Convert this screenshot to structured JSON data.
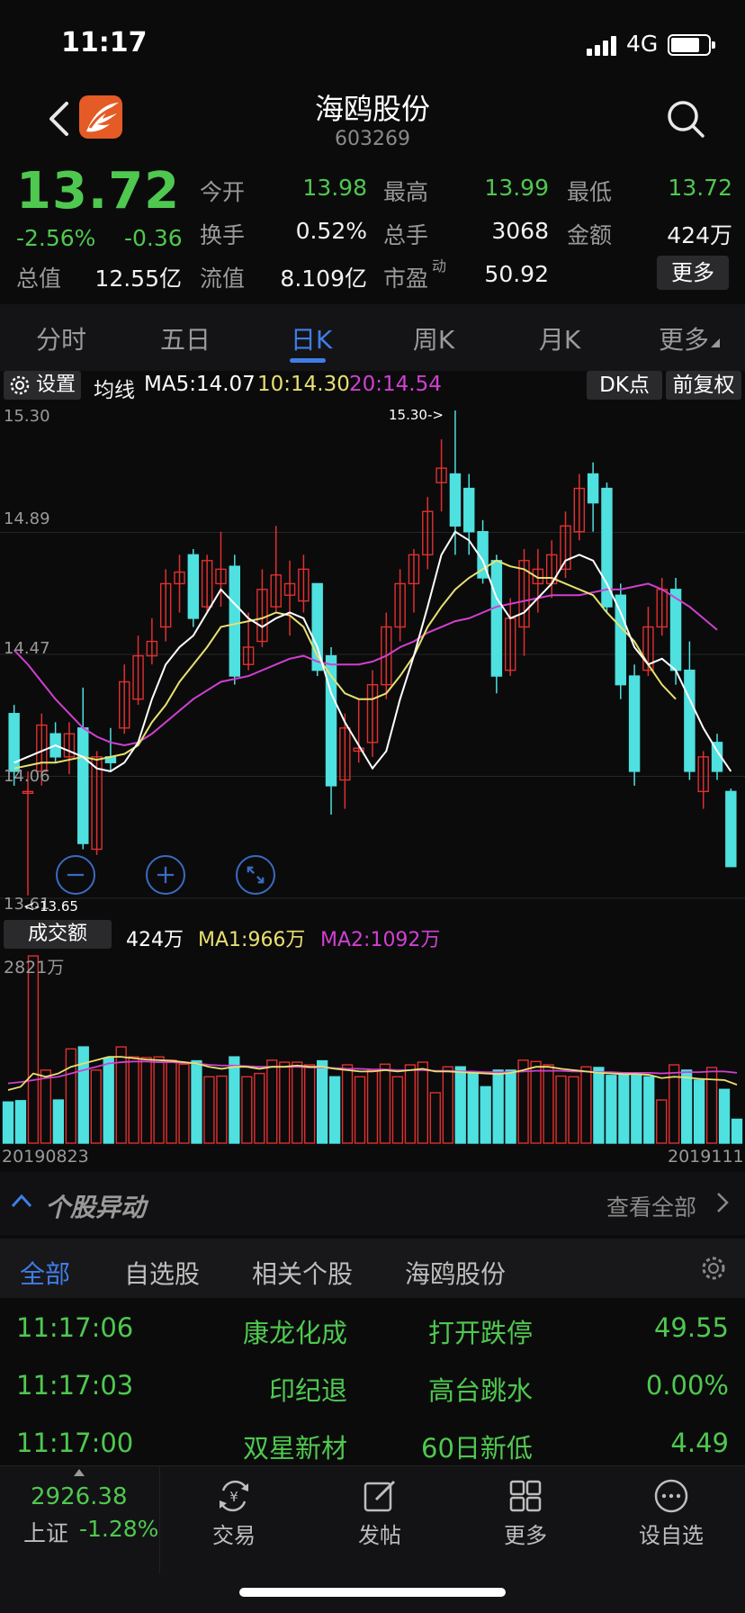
{
  "status": {
    "time": "11:17",
    "network": "4G"
  },
  "header": {
    "title": "海鸥股份",
    "code": "603269"
  },
  "quote": {
    "price": "13.72",
    "pct": "-2.56%",
    "change": "-0.36",
    "fields": [
      {
        "label": "今开",
        "value": "13.98",
        "color": "#4fc84f"
      },
      {
        "label": "最高",
        "value": "13.99",
        "color": "#4fc84f"
      },
      {
        "label": "最低",
        "value": "13.72",
        "color": "#4fc84f"
      },
      {
        "label": "换手",
        "value": "0.52%",
        "color": "#f2f2f2"
      },
      {
        "label": "总手",
        "value": "3068",
        "color": "#f2f2f2"
      },
      {
        "label": "金额",
        "value": "424万",
        "color": "#f2f2f2"
      },
      {
        "label": "总值",
        "value": "12.55亿",
        "color": "#f2f2f2"
      },
      {
        "label": "流值",
        "value": "8.109亿",
        "color": "#f2f2f2"
      },
      {
        "label": "市盈",
        "sup": "动",
        "value": "50.92",
        "color": "#f2f2f2"
      }
    ],
    "more_label": "更多"
  },
  "tabs": [
    "分时",
    "五日",
    "日K",
    "周K",
    "月K",
    "更多"
  ],
  "active_tab": "日K",
  "ma_bar": {
    "settings_label": "设置",
    "prefix": "均线",
    "ma5": "MA5:14.07",
    "ma10": "10:14.30",
    "ma20": "20:14.54",
    "dk_label": "DK点",
    "fq_label": "前复权"
  },
  "colors": {
    "up": "#e0302f",
    "down": "#4fe0e0",
    "ma5": "#ffffff",
    "ma10": "#e8e070",
    "ma20": "#d040d0",
    "accent": "#3f7ee8",
    "green": "#4fc84f"
  },
  "chart_data": {
    "type": "candlestick",
    "y_ticks": [
      "15.30",
      "14.89",
      "14.47",
      "14.06",
      "13.61"
    ],
    "ylim": [
      13.61,
      15.3
    ],
    "max_annotation": "15.30->",
    "min_annotation": "<-13.65",
    "candles": [
      {
        "o": 14.25,
        "h": 14.28,
        "l": 14.0,
        "c": 14.05
      },
      {
        "o": 13.98,
        "h": 14.05,
        "l": 13.62,
        "c": 13.98
      },
      {
        "o": 14.05,
        "h": 14.25,
        "l": 14.0,
        "c": 14.21
      },
      {
        "o": 14.18,
        "h": 14.22,
        "l": 14.08,
        "c": 14.1
      },
      {
        "o": 14.1,
        "h": 14.22,
        "l": 14.04,
        "c": 14.18
      },
      {
        "o": 14.2,
        "h": 14.34,
        "l": 13.78,
        "c": 13.8
      },
      {
        "o": 13.78,
        "h": 14.12,
        "l": 13.76,
        "c": 14.1
      },
      {
        "o": 14.1,
        "h": 14.2,
        "l": 14.05,
        "c": 14.08
      },
      {
        "o": 14.2,
        "h": 14.42,
        "l": 14.18,
        "c": 14.36
      },
      {
        "o": 14.3,
        "h": 14.52,
        "l": 14.28,
        "c": 14.45
      },
      {
        "o": 14.45,
        "h": 14.58,
        "l": 14.42,
        "c": 14.5
      },
      {
        "o": 14.55,
        "h": 14.75,
        "l": 14.5,
        "c": 14.7
      },
      {
        "o": 14.7,
        "h": 14.8,
        "l": 14.6,
        "c": 14.74
      },
      {
        "o": 14.8,
        "h": 14.82,
        "l": 14.55,
        "c": 14.58
      },
      {
        "o": 14.62,
        "h": 14.8,
        "l": 14.6,
        "c": 14.78
      },
      {
        "o": 14.7,
        "h": 14.88,
        "l": 14.62,
        "c": 14.75
      },
      {
        "o": 14.76,
        "h": 14.8,
        "l": 14.35,
        "c": 14.38
      },
      {
        "o": 14.42,
        "h": 14.6,
        "l": 14.4,
        "c": 14.48
      },
      {
        "o": 14.5,
        "h": 14.75,
        "l": 14.48,
        "c": 14.68
      },
      {
        "o": 14.62,
        "h": 14.9,
        "l": 14.6,
        "c": 14.73
      },
      {
        "o": 14.66,
        "h": 14.78,
        "l": 14.52,
        "c": 14.7
      },
      {
        "o": 14.64,
        "h": 14.8,
        "l": 14.6,
        "c": 14.75
      },
      {
        "o": 14.7,
        "h": 14.7,
        "l": 14.38,
        "c": 14.4
      },
      {
        "o": 14.45,
        "h": 14.48,
        "l": 13.9,
        "c": 14.0
      },
      {
        "o": 14.02,
        "h": 14.25,
        "l": 13.92,
        "c": 14.2
      },
      {
        "o": 14.12,
        "h": 14.3,
        "l": 14.08,
        "c": 14.13
      },
      {
        "o": 14.15,
        "h": 14.4,
        "l": 14.1,
        "c": 14.35
      },
      {
        "o": 14.35,
        "h": 14.6,
        "l": 14.3,
        "c": 14.55
      },
      {
        "o": 14.55,
        "h": 14.75,
        "l": 14.5,
        "c": 14.7
      },
      {
        "o": 14.7,
        "h": 14.82,
        "l": 14.6,
        "c": 14.8
      },
      {
        "o": 14.8,
        "h": 15.0,
        "l": 14.75,
        "c": 14.95
      },
      {
        "o": 15.05,
        "h": 15.2,
        "l": 14.95,
        "c": 15.1
      },
      {
        "o": 15.08,
        "h": 15.3,
        "l": 14.8,
        "c": 14.9
      },
      {
        "o": 15.03,
        "h": 15.08,
        "l": 14.8,
        "c": 14.88
      },
      {
        "o": 14.88,
        "h": 14.92,
        "l": 14.7,
        "c": 14.72
      },
      {
        "o": 14.78,
        "h": 14.8,
        "l": 14.32,
        "c": 14.38
      },
      {
        "o": 14.4,
        "h": 14.65,
        "l": 14.38,
        "c": 14.58
      },
      {
        "o": 14.55,
        "h": 14.82,
        "l": 14.45,
        "c": 14.78
      },
      {
        "o": 14.7,
        "h": 14.82,
        "l": 14.6,
        "c": 14.75
      },
      {
        "o": 14.7,
        "h": 14.85,
        "l": 14.65,
        "c": 14.8
      },
      {
        "o": 14.75,
        "h": 14.95,
        "l": 14.72,
        "c": 14.9
      },
      {
        "o": 14.88,
        "h": 15.08,
        "l": 14.85,
        "c": 15.03
      },
      {
        "o": 15.08,
        "h": 15.12,
        "l": 14.88,
        "c": 14.98
      },
      {
        "o": 15.03,
        "h": 15.05,
        "l": 14.6,
        "c": 14.62
      },
      {
        "o": 14.66,
        "h": 14.7,
        "l": 14.3,
        "c": 14.35
      },
      {
        "o": 14.38,
        "h": 14.42,
        "l": 14.0,
        "c": 14.05
      },
      {
        "o": 14.4,
        "h": 14.62,
        "l": 14.38,
        "c": 14.55
      },
      {
        "o": 14.55,
        "h": 14.72,
        "l": 14.52,
        "c": 14.68
      },
      {
        "o": 14.68,
        "h": 14.72,
        "l": 14.35,
        "c": 14.4
      },
      {
        "o": 14.4,
        "h": 14.5,
        "l": 14.02,
        "c": 14.05
      },
      {
        "o": 13.98,
        "h": 14.12,
        "l": 13.92,
        "c": 14.1
      },
      {
        "o": 14.15,
        "h": 14.18,
        "l": 14.02,
        "c": 14.05
      },
      {
        "o": 13.98,
        "h": 13.99,
        "l": 13.72,
        "c": 13.72
      }
    ],
    "ma5": [
      14.08,
      14.1,
      14.12,
      14.14,
      14.12,
      14.1,
      14.06,
      14.05,
      14.08,
      14.15,
      14.3,
      14.42,
      14.48,
      14.52,
      14.6,
      14.68,
      14.63,
      14.58,
      14.55,
      14.58,
      14.6,
      14.58,
      14.48,
      14.32,
      14.22,
      14.14,
      14.06,
      14.12,
      14.3,
      14.45,
      14.62,
      14.8,
      14.88,
      14.85,
      14.78,
      14.65,
      14.58,
      14.6,
      14.65,
      14.7,
      14.78,
      14.8,
      14.78,
      14.7,
      14.6,
      14.48,
      14.42,
      14.44,
      14.4,
      14.3,
      14.2,
      14.12,
      14.05
    ],
    "ma10": [
      14.06,
      14.07,
      14.08,
      14.08,
      14.09,
      14.1,
      14.09,
      14.1,
      14.11,
      14.14,
      14.22,
      14.28,
      14.36,
      14.42,
      14.48,
      14.55,
      14.56,
      14.57,
      14.58,
      14.6,
      14.59,
      14.55,
      14.45,
      14.38,
      14.32,
      14.3,
      14.3,
      14.32,
      14.38,
      14.45,
      14.55,
      14.62,
      14.68,
      14.72,
      14.75,
      14.78,
      14.76,
      14.75,
      14.72,
      14.72,
      14.7,
      14.68,
      14.66,
      14.6,
      14.55,
      14.5,
      14.42,
      14.35,
      14.3
    ],
    "ma20": [
      14.47,
      14.42,
      14.36,
      14.3,
      14.25,
      14.2,
      14.17,
      14.15,
      14.14,
      14.15,
      14.18,
      14.22,
      14.26,
      14.3,
      14.33,
      14.36,
      14.37,
      14.38,
      14.4,
      14.42,
      14.44,
      14.45,
      14.43,
      14.42,
      14.42,
      14.42,
      14.43,
      14.45,
      14.48,
      14.5,
      14.53,
      14.55,
      14.57,
      14.58,
      14.6,
      14.62,
      14.63,
      14.64,
      14.65,
      14.66,
      14.66,
      14.66,
      14.67,
      14.68,
      14.68,
      14.69,
      14.7,
      14.68,
      14.65,
      14.62,
      14.58,
      14.54
    ],
    "volume_header": {
      "label": "成交额",
      "value": "424万",
      "ma1": "MA1:966万",
      "ma2": "MA2:1092万"
    },
    "volume_max_label": "2821万",
    "volume_max": 2821,
    "date_start": "20190823",
    "date_end": "20191111",
    "volumes": [
      620,
      640,
      2821,
      1100,
      650,
      1420,
      1450,
      1100,
      1280,
      1450,
      1300,
      1290,
      1300,
      1250,
      1190,
      1240,
      1000,
      1010,
      1300,
      1000,
      1050,
      1250,
      1220,
      1220,
      1180,
      1240,
      1000,
      1180,
      1000,
      1100,
      1190,
      1000,
      1180,
      1220,
      760,
      1150,
      1150,
      1050,
      850,
      1100,
      1100,
      1250,
      1230,
      1180,
      1010,
      1000,
      1150,
      1140,
      1020,
      1050,
      1020,
      1000,
      650,
      1180,
      1100,
      950,
      1140,
      810,
      360
    ],
    "vol_ma1": [
      800,
      850,
      1050,
      1000,
      1050,
      1150,
      1200,
      1250,
      1300,
      1300,
      1280,
      1260,
      1250,
      1240,
      1220,
      1200,
      1150,
      1120,
      1150,
      1150,
      1120,
      1150,
      1150,
      1170,
      1150,
      1150,
      1120,
      1100,
      1080,
      1080,
      1100,
      1080,
      1100,
      1120,
      1080,
      1080,
      1070,
      1060,
      1050,
      1040,
      1060,
      1100,
      1150,
      1150,
      1120,
      1100,
      1080,
      1060,
      1050,
      1040,
      1040,
      1030,
      980,
      1000,
      990,
      970,
      960,
      950,
      880
    ],
    "vol_ma2": [
      900,
      920,
      950,
      980,
      1000,
      1050,
      1100,
      1150,
      1200,
      1220,
      1230,
      1230,
      1220,
      1220,
      1210,
      1200,
      1180,
      1170,
      1170,
      1160,
      1150,
      1150,
      1150,
      1150,
      1140,
      1140,
      1130,
      1120,
      1120,
      1110,
      1110,
      1100,
      1100,
      1100,
      1090,
      1090,
      1080,
      1080,
      1070,
      1070,
      1070,
      1080,
      1090,
      1090,
      1090,
      1080,
      1080,
      1070,
      1070,
      1060,
      1060,
      1060,
      1050,
      1060,
      1070,
      1070,
      1080,
      1080,
      1060
    ]
  },
  "anomaly": {
    "title": "个股异动",
    "view_all": "查看全部"
  },
  "filter_tabs": [
    "全部",
    "自选股",
    "相关个股",
    "海鸥股份"
  ],
  "alerts": [
    {
      "time": "11:17:06",
      "name": "康龙化成",
      "event": "打开跌停",
      "value": "49.55"
    },
    {
      "time": "11:17:03",
      "name": "印纪退",
      "event": "高台跳水",
      "value": "0.00%"
    },
    {
      "time": "11:17:00",
      "name": "双星新材",
      "event": "60日新低",
      "value": "4.49"
    }
  ],
  "bottom": {
    "index_value": "2926.38",
    "index_name": "上证",
    "index_pct": "-1.28%",
    "items": [
      {
        "label": "交易",
        "icon": "trade-icon"
      },
      {
        "label": "发帖",
        "icon": "edit-icon"
      },
      {
        "label": "更多",
        "icon": "grid-icon"
      },
      {
        "label": "设自选",
        "icon": "add-watchlist-icon"
      }
    ]
  }
}
